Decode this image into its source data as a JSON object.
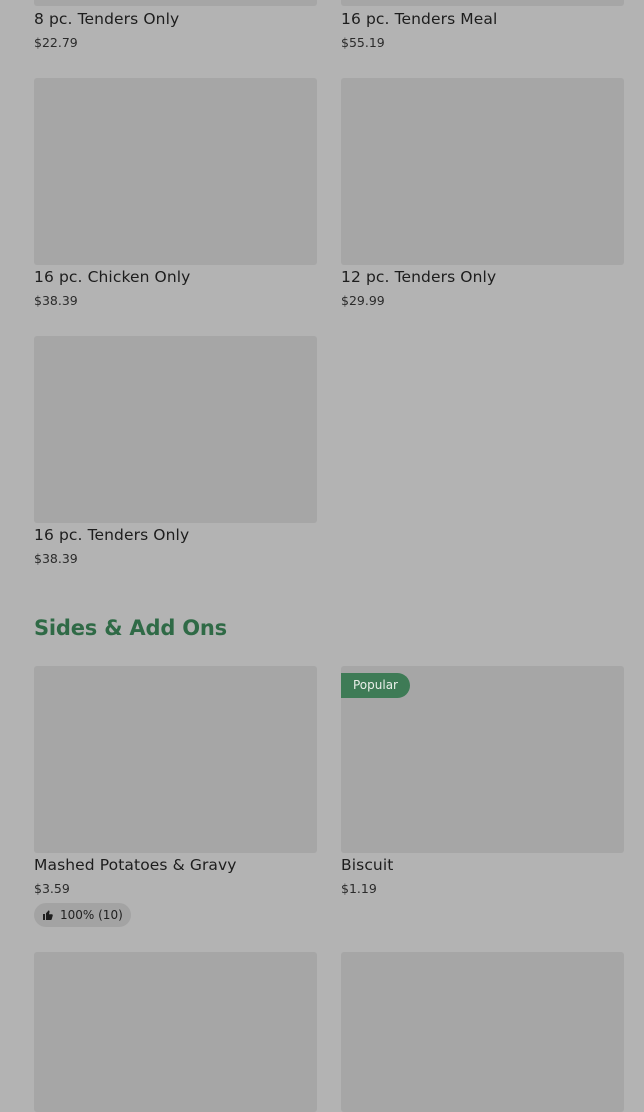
{
  "items_top": [
    {
      "name": "8 pc. Tenders Only",
      "price": "$22.79"
    },
    {
      "name": "16 pc. Tenders Meal",
      "price": "$55.19"
    },
    {
      "name": "16 pc. Chicken Only",
      "price": "$38.39"
    },
    {
      "name": "12 pc. Tenders Only",
      "price": "$29.99"
    },
    {
      "name": "16 pc. Tenders Only",
      "price": "$38.39"
    }
  ],
  "sides_section": {
    "title": "Sides & Add Ons",
    "items": [
      {
        "name": "Mashed Potatoes & Gravy",
        "price": "$3.59",
        "rating": "100% (10)"
      },
      {
        "name": "Biscuit",
        "price": "$1.19",
        "badge": "Popular"
      }
    ]
  },
  "icons": {
    "rating": "thumbs-up-icon"
  }
}
